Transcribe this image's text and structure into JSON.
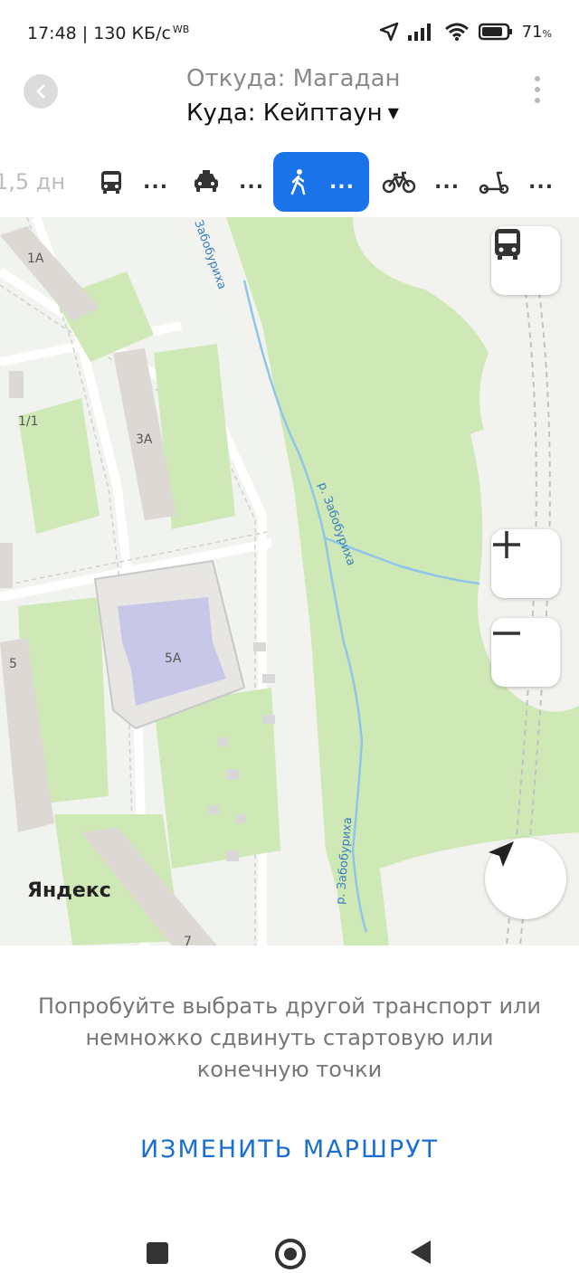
{
  "status_bar": {
    "time": "17:48 | 130 КБ/с",
    "carrier_tag": "WB",
    "battery_percent": "71",
    "battery_unit": "%",
    "icons": [
      "location-arrow-icon",
      "signal-icon",
      "wifi-icon",
      "battery-icon"
    ]
  },
  "header": {
    "from": "Откуда: Магадан",
    "to": "Куда: Кейптаун",
    "to_caret": "▼"
  },
  "transport_modes": [
    {
      "name": "time",
      "label": "1,5 дн"
    },
    {
      "name": "bus",
      "label": "..."
    },
    {
      "name": "taxi",
      "label": "..."
    },
    {
      "name": "walk",
      "label": "...",
      "active": true
    },
    {
      "name": "bike",
      "label": "..."
    },
    {
      "name": "scooter",
      "label": "..."
    }
  ],
  "map": {
    "labels": {
      "b1a": "1А",
      "b11": "1/1",
      "b3a": "3А",
      "b5a": "5А",
      "b5": "5",
      "b7": "7",
      "river1": "Забобуриха",
      "river2": "р. Забобуриха",
      "river3": "р. Забобуриха"
    },
    "logo": "Яндекс"
  },
  "sheet": {
    "message": "Попробуйте выбрать другой транспорт или немножко сдвинуть стартовую или конечную точки",
    "action": "ИЗМЕНИТЬ МАРШРУТ"
  },
  "colors": {
    "accent": "#1a73e8",
    "action_text": "#1a6fd1",
    "park": "#cfe9b6",
    "urban": "#f1f3ee",
    "building": "#dcd8d4",
    "school": "#c9c7e8"
  }
}
